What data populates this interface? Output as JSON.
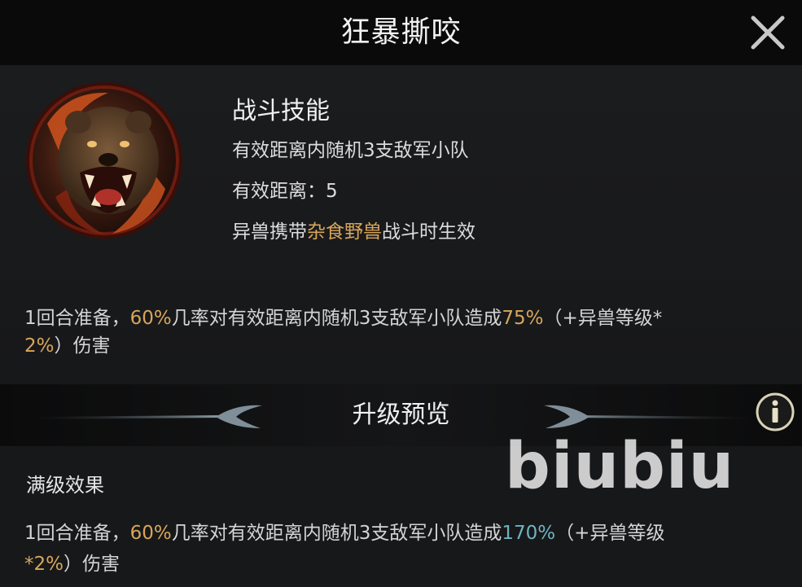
{
  "header": {
    "title": "狂暴撕咬"
  },
  "skill": {
    "icon": "bear-icon",
    "heading": "战斗技能",
    "range_target": "有效距离内随机3支敌军小队",
    "range_label": "有效距离：5",
    "condition_prefix": "异兽携带",
    "condition_highlight": "杂食野兽",
    "condition_suffix": "战斗时生效"
  },
  "current_effect": {
    "part1": "1回合准备，",
    "chance": "60%",
    "part2": "几率对有效距离内随机3支敌军小队造成",
    "damage": "75%",
    "part3": "（+异兽等级*",
    "scale": "2%",
    "part4": "）伤害"
  },
  "upgrade": {
    "title": "升级预览",
    "max_label": "满级效果",
    "part1": "1回合准备，",
    "chance": "60%",
    "part2": "几率对有效距离内随机3支敌军小队造成",
    "damage": "170%",
    "part3": "（+异兽等级",
    "scale": "*2%",
    "part4": "）伤害"
  },
  "watermark": "biubiu",
  "colors": {
    "highlight_gold": "#d7a65a",
    "highlight_teal": "#6fb3c0"
  }
}
